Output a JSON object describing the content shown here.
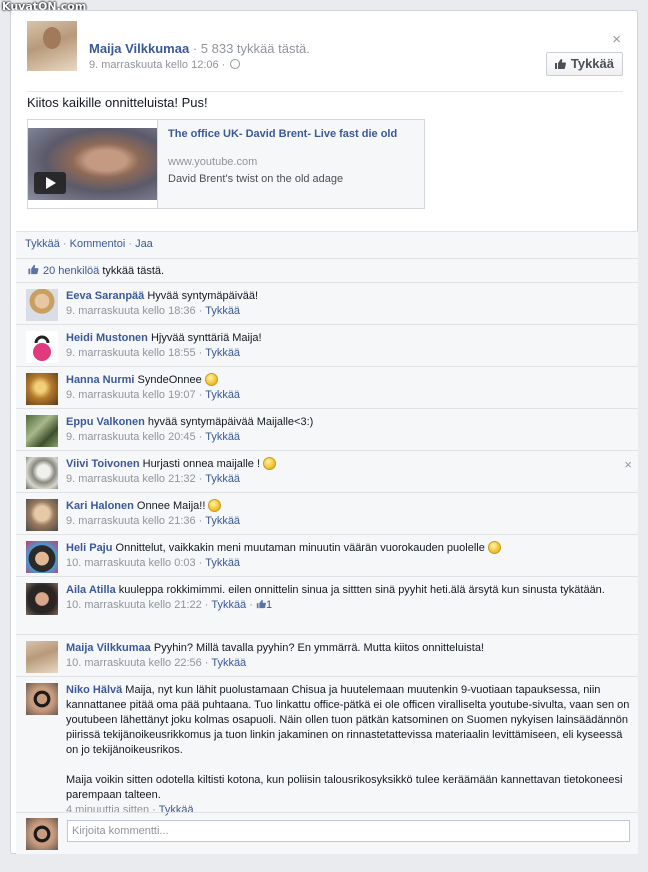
{
  "watermark": "KuvatON.com",
  "post": {
    "author": "Maija Vilkkumaa",
    "likes_inline": " · 5 833 tykkää tästä.",
    "timestamp": "9. marraskuuta kello 12:06 · ",
    "like_button": "Tykkää",
    "close": "×",
    "text": "Kiitos kaikille onnitteluista! Pus!",
    "link": {
      "title": "The office UK- David Brent- Live fast die old",
      "domain": "www.youtube.com",
      "description": "David Brent's twist on the old adage"
    }
  },
  "actions": {
    "like": "Tykkää",
    "comment": "Kommentoi",
    "share": "Jaa",
    "sep": " · "
  },
  "likes_summary": {
    "count": "20 henkilöä",
    "suffix": " tykkää tästä."
  },
  "comments": [
    {
      "name": "Eeva Saranpää",
      "text": " Hyvää syntymäpäivää!",
      "meta": "9. marraskuuta kello 18:36 · ",
      "like": "Tykkää"
    },
    {
      "name": "Heidi Mustonen",
      "text": " Hjyvää synttäriä Maija!",
      "meta": "9. marraskuuta kello 18:55 · ",
      "like": "Tykkää"
    },
    {
      "name": "Hanna Nurmi",
      "text": " SyndeOnnee ",
      "meta": "9. marraskuuta kello 19:07 · ",
      "like": "Tykkää"
    },
    {
      "name": "Eppu Valkonen",
      "text": " hyvää syntymäpäivää Maijalle<3:)",
      "meta": "9. marraskuuta kello 20:45 · ",
      "like": "Tykkää"
    },
    {
      "name": "Viivi Toivonen",
      "text": " Hurjasti onnea maijalle ! ",
      "meta": "9. marraskuuta kello 21:32 · ",
      "like": "Tykkää",
      "close": "×"
    },
    {
      "name": "Kari Halonen",
      "text": " Onnee Maija!! ",
      "meta": "9. marraskuuta kello 21:36 · ",
      "like": "Tykkää"
    },
    {
      "name": "Heli Paju",
      "text": " Onnittelut, vaikkakin meni muutaman minuutin väärän vuorokauden puolelle ",
      "meta": "10. marraskuuta kello 0:03 · ",
      "like": "Tykkää"
    },
    {
      "name": "Aila Atilla",
      "text": " kuuleppa rokkimimmi. eilen onnittelin sinua ja sittten sinä pyyhit heti.älä ärsytä kun sinusta tykätään.",
      "meta": "10. marraskuuta kello 21:22 · ",
      "like": "Tykkää",
      "like_count": "1"
    },
    {
      "name": "Maija Vilkkumaa",
      "text": " Pyyhin? Millä tavalla pyyhin? En ymmärrä. Mutta kiitos onnitteluista!",
      "meta": "10. marraskuuta kello 22:56 · ",
      "like": "Tykkää"
    },
    {
      "name": "Niko Hälvä",
      "text": " Maija, nyt kun lähit puolustamaan Chisua ja huutelemaan muutenkin 9-vuotiaan tapauksessa, niin kannattanee pitää oma pää puhtaana. Tuo linkattu office-pätkä ei ole officen viralliselta youtube-sivulta, vaan sen on youtubeen lähettänyt joku kolmas osapuoli. Näin ollen tuon pätkän katsominen on Suomen nykyisen lainsäädännön piirissä tekijänoikeusrikkomus ja tuon linkin jakaminen on rinnastetattevissa materiaalin levittämiseen, eli kyseessä on jo tekijänoikeusrikos.",
      "text2": "Maija voikin sitten odotella kiltisti kotona, kun poliisin talousrikosyksikkö tulee keräämään kannettavan tietokoneesi parempaan talteen.",
      "meta": "4 minuuttia sitten · ",
      "like": "Tykkää"
    }
  ],
  "write_comment": {
    "placeholder": "Kirjoita kommentti..."
  },
  "colors": {
    "link": "#3b5998",
    "muted": "#90949c",
    "feedback_bg": "#f6f7f9"
  },
  "icons": [
    "globe-icon",
    "thumbs-up-icon",
    "close-icon",
    "play-icon",
    "smiley-icon"
  ]
}
